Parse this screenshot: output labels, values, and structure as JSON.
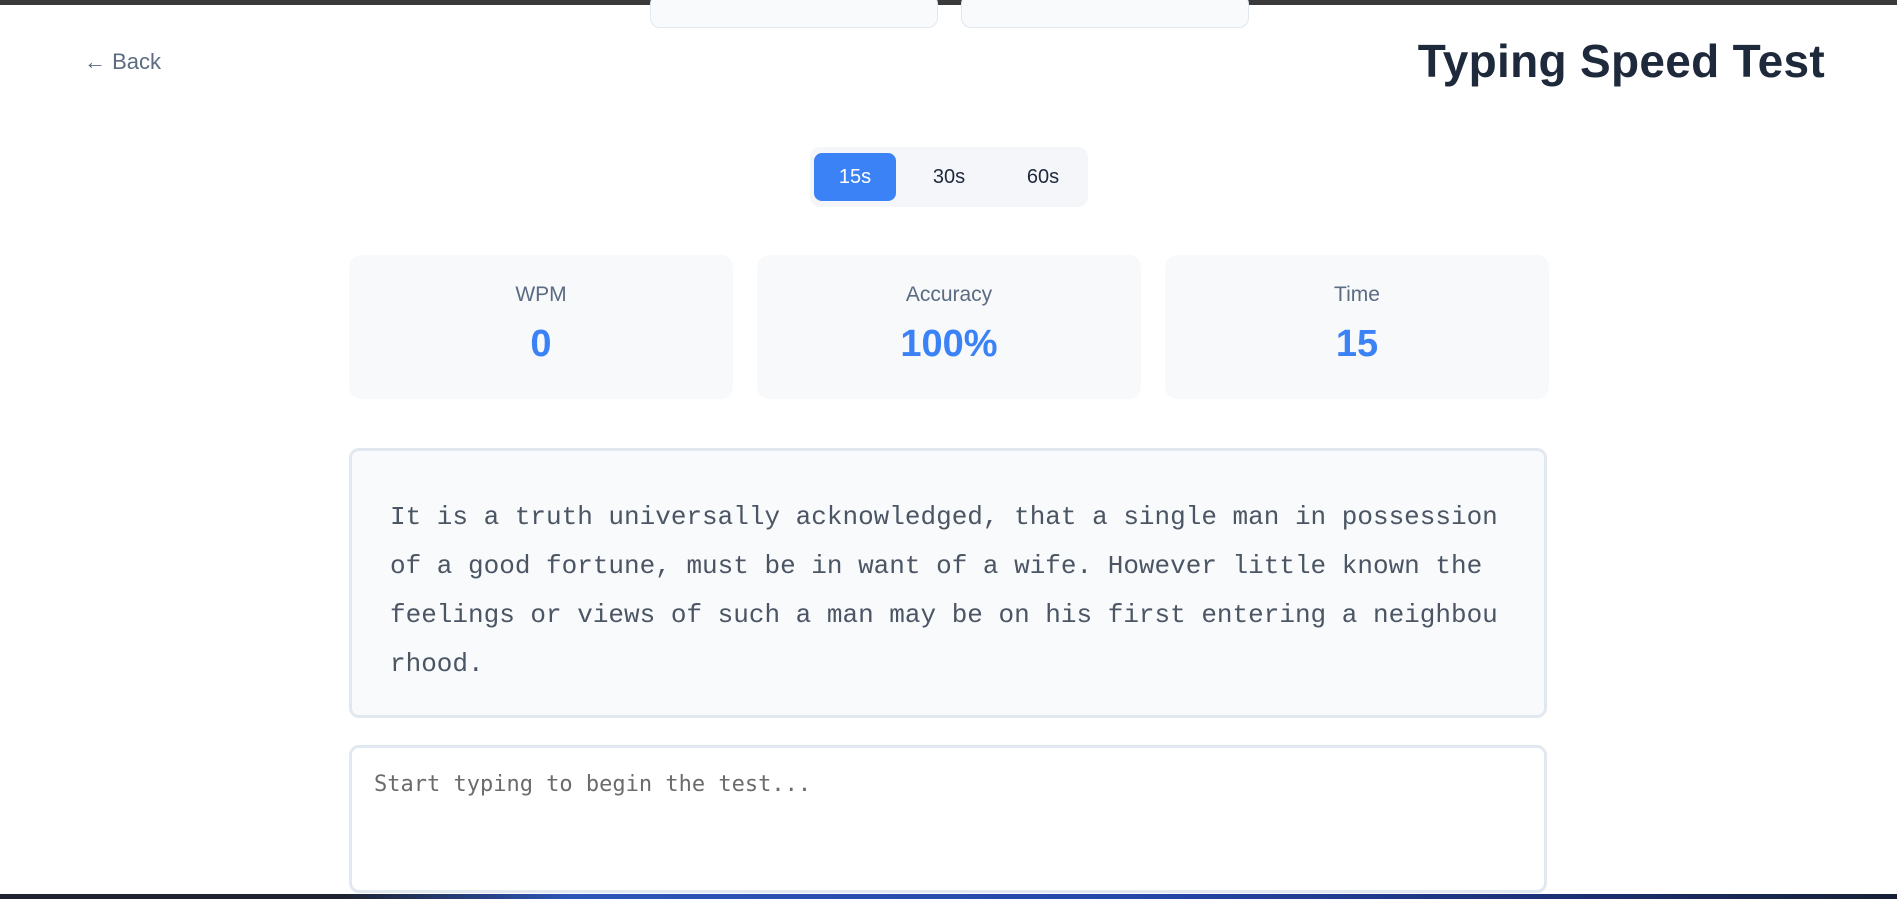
{
  "header": {
    "back_label": "← Back",
    "title": "Typing Speed Test"
  },
  "durations": {
    "options": [
      "15s",
      "30s",
      "60s"
    ],
    "selected": "15s"
  },
  "stats": [
    {
      "label": "WPM",
      "value": "0"
    },
    {
      "label": "Accuracy",
      "value": "100%"
    },
    {
      "label": "Time",
      "value": "15"
    }
  ],
  "passage": {
    "text": "It is a truth universally acknowledged, that a single man in possession of a good fortune, must be in want of a wife. However little known the feelings or views of such a man may be on his first entering a neighbourhood."
  },
  "input": {
    "placeholder": "Start typing to begin the test...",
    "value": ""
  },
  "colors": {
    "accent": "#3b82f6",
    "title": "#1e293b",
    "muted": "#5b6b82",
    "card_bg": "#f7f9fb",
    "border": "#e2e8f0"
  }
}
